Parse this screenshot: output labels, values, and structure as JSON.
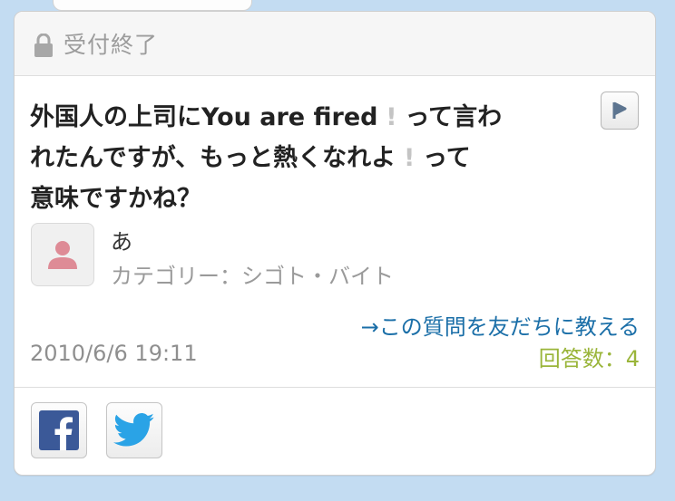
{
  "status": {
    "label": "受付終了",
    "icon": "lock-icon"
  },
  "question": {
    "part1": "外国人の上司にYou are fired",
    "part2": "って言わ",
    "part3": "れたんですが、もっと熱くなれよ",
    "part4": "って",
    "part5": "意味ですかね？",
    "exclamation": "!"
  },
  "user": {
    "name": "あ",
    "category": "カテゴリー：シゴト・バイト"
  },
  "share_link": "→この質問を友だちに教える",
  "date": "2010/6/6 19:11",
  "answers": "回答数：4",
  "colors": {
    "background": "#c3dcf2",
    "link": "#1b6fa8",
    "answers": "#9ab53a",
    "facebook": "#3b5998",
    "twitter": "#1da1f2"
  },
  "icons": {
    "report": "play-icon",
    "facebook": "facebook-icon",
    "twitter": "twitter-icon",
    "avatar": "person-icon"
  }
}
